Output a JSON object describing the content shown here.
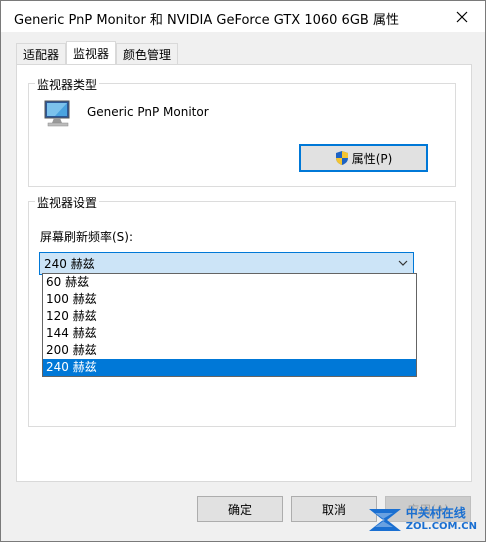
{
  "window": {
    "title": "Generic PnP Monitor 和 NVIDIA GeForce GTX 1060 6GB 属性",
    "close_icon": "close-icon"
  },
  "tabs": [
    {
      "label": "适配器",
      "active": false
    },
    {
      "label": "监视器",
      "active": true
    },
    {
      "label": "颜色管理",
      "active": false
    }
  ],
  "monitor_type": {
    "legend": "监视器类型",
    "name": "Generic PnP Monitor",
    "icon": "monitor-icon",
    "properties_button": "属性(P)",
    "shield_icon": "shield-icon"
  },
  "monitor_settings": {
    "legend": "监视器设置",
    "refresh_label": "屏幕刷新频率(S):",
    "selected_rate": "240 赫兹",
    "options": [
      "60 赫兹",
      "100 赫兹",
      "120 赫兹",
      "144 赫兹",
      "200 赫兹",
      "240 赫兹"
    ],
    "selected_index": 5
  },
  "footer": {
    "ok": "确定",
    "cancel": "取消",
    "apply": "应用(A)"
  },
  "watermark": {
    "cn": "中关村在线",
    "url": "ZOL.COM.CN"
  },
  "colors": {
    "accent": "#0078d7",
    "combo_bg": "#cce4f7",
    "dialog_bg": "#f0f0f0"
  }
}
